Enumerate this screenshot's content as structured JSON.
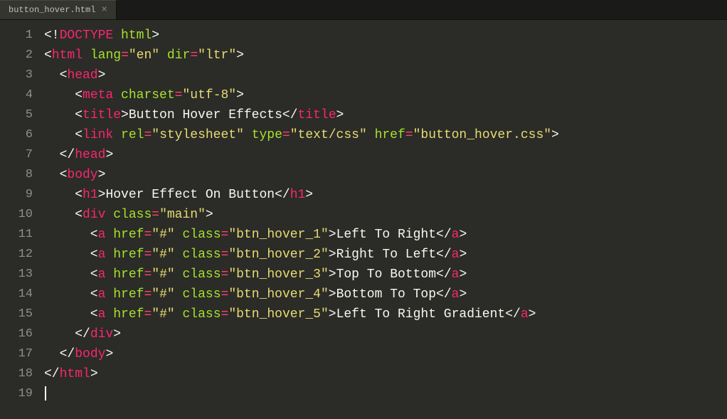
{
  "tab": {
    "filename": "button_hover.html",
    "close_glyph": "×"
  },
  "line_numbers": [
    "1",
    "2",
    "3",
    "4",
    "5",
    "6",
    "7",
    "8",
    "9",
    "10",
    "11",
    "12",
    "13",
    "14",
    "15",
    "16",
    "17",
    "18",
    "19"
  ],
  "code_lines": [
    [
      {
        "c": "pn",
        "t": "<!"
      },
      {
        "c": "tg",
        "t": "DOCTYPE"
      },
      {
        "c": "pn",
        "t": " "
      },
      {
        "c": "an",
        "t": "html"
      },
      {
        "c": "pn",
        "t": ">"
      }
    ],
    [
      {
        "c": "pn",
        "t": "<"
      },
      {
        "c": "tg",
        "t": "html"
      },
      {
        "c": "pn",
        "t": " "
      },
      {
        "c": "an",
        "t": "lang"
      },
      {
        "c": "op",
        "t": "="
      },
      {
        "c": "st",
        "t": "\"en\""
      },
      {
        "c": "pn",
        "t": " "
      },
      {
        "c": "an",
        "t": "dir"
      },
      {
        "c": "op",
        "t": "="
      },
      {
        "c": "st",
        "t": "\"ltr\""
      },
      {
        "c": "pn",
        "t": ">"
      }
    ],
    [
      {
        "c": "pn",
        "t": "  <"
      },
      {
        "c": "tg",
        "t": "head"
      },
      {
        "c": "pn",
        "t": ">"
      }
    ],
    [
      {
        "c": "pn",
        "t": "    <"
      },
      {
        "c": "tg",
        "t": "meta"
      },
      {
        "c": "pn",
        "t": " "
      },
      {
        "c": "an",
        "t": "charset"
      },
      {
        "c": "op",
        "t": "="
      },
      {
        "c": "st",
        "t": "\"utf-8\""
      },
      {
        "c": "pn",
        "t": ">"
      }
    ],
    [
      {
        "c": "pn",
        "t": "    <"
      },
      {
        "c": "tg",
        "t": "title"
      },
      {
        "c": "pn",
        "t": ">"
      },
      {
        "c": "tx",
        "t": "Button Hover Effects"
      },
      {
        "c": "pn",
        "t": "</"
      },
      {
        "c": "tg",
        "t": "title"
      },
      {
        "c": "pn",
        "t": ">"
      }
    ],
    [
      {
        "c": "pn",
        "t": "    <"
      },
      {
        "c": "tg",
        "t": "link"
      },
      {
        "c": "pn",
        "t": " "
      },
      {
        "c": "an",
        "t": "rel"
      },
      {
        "c": "op",
        "t": "="
      },
      {
        "c": "st",
        "t": "\"stylesheet\""
      },
      {
        "c": "pn",
        "t": " "
      },
      {
        "c": "an",
        "t": "type"
      },
      {
        "c": "op",
        "t": "="
      },
      {
        "c": "st",
        "t": "\"text/css\""
      },
      {
        "c": "pn",
        "t": " "
      },
      {
        "c": "an",
        "t": "href"
      },
      {
        "c": "op",
        "t": "="
      },
      {
        "c": "st",
        "t": "\"button_hover.css\""
      },
      {
        "c": "pn",
        "t": ">"
      }
    ],
    [
      {
        "c": "pn",
        "t": "  </"
      },
      {
        "c": "tg",
        "t": "head"
      },
      {
        "c": "pn",
        "t": ">"
      }
    ],
    [
      {
        "c": "pn",
        "t": "  <"
      },
      {
        "c": "tg",
        "t": "body"
      },
      {
        "c": "pn",
        "t": ">"
      }
    ],
    [
      {
        "c": "pn",
        "t": "    <"
      },
      {
        "c": "tg",
        "t": "h1"
      },
      {
        "c": "pn",
        "t": ">"
      },
      {
        "c": "tx",
        "t": "Hover Effect On Button"
      },
      {
        "c": "pn",
        "t": "</"
      },
      {
        "c": "tg",
        "t": "h1"
      },
      {
        "c": "pn",
        "t": ">"
      }
    ],
    [
      {
        "c": "pn",
        "t": "    <"
      },
      {
        "c": "tg",
        "t": "div"
      },
      {
        "c": "pn",
        "t": " "
      },
      {
        "c": "an",
        "t": "class"
      },
      {
        "c": "op",
        "t": "="
      },
      {
        "c": "st",
        "t": "\"main\""
      },
      {
        "c": "pn",
        "t": ">"
      }
    ],
    [
      {
        "c": "pn",
        "t": "      <"
      },
      {
        "c": "tg",
        "t": "a"
      },
      {
        "c": "pn",
        "t": " "
      },
      {
        "c": "an",
        "t": "href"
      },
      {
        "c": "op",
        "t": "="
      },
      {
        "c": "st",
        "t": "\"#\""
      },
      {
        "c": "pn",
        "t": " "
      },
      {
        "c": "an",
        "t": "class"
      },
      {
        "c": "op",
        "t": "="
      },
      {
        "c": "st",
        "t": "\"btn_hover_1\""
      },
      {
        "c": "pn",
        "t": ">"
      },
      {
        "c": "tx",
        "t": "Left To Right"
      },
      {
        "c": "pn",
        "t": "</"
      },
      {
        "c": "tg",
        "t": "a"
      },
      {
        "c": "pn",
        "t": ">"
      }
    ],
    [
      {
        "c": "pn",
        "t": "      <"
      },
      {
        "c": "tg",
        "t": "a"
      },
      {
        "c": "pn",
        "t": " "
      },
      {
        "c": "an",
        "t": "href"
      },
      {
        "c": "op",
        "t": "="
      },
      {
        "c": "st",
        "t": "\"#\""
      },
      {
        "c": "pn",
        "t": " "
      },
      {
        "c": "an",
        "t": "class"
      },
      {
        "c": "op",
        "t": "="
      },
      {
        "c": "st",
        "t": "\"btn_hover_2\""
      },
      {
        "c": "pn",
        "t": ">"
      },
      {
        "c": "tx",
        "t": "Right To Left"
      },
      {
        "c": "pn",
        "t": "</"
      },
      {
        "c": "tg",
        "t": "a"
      },
      {
        "c": "pn",
        "t": ">"
      }
    ],
    [
      {
        "c": "pn",
        "t": "      <"
      },
      {
        "c": "tg",
        "t": "a"
      },
      {
        "c": "pn",
        "t": " "
      },
      {
        "c": "an",
        "t": "href"
      },
      {
        "c": "op",
        "t": "="
      },
      {
        "c": "st",
        "t": "\"#\""
      },
      {
        "c": "pn",
        "t": " "
      },
      {
        "c": "an",
        "t": "class"
      },
      {
        "c": "op",
        "t": "="
      },
      {
        "c": "st",
        "t": "\"btn_hover_3\""
      },
      {
        "c": "pn",
        "t": ">"
      },
      {
        "c": "tx",
        "t": "Top To Bottom"
      },
      {
        "c": "pn",
        "t": "</"
      },
      {
        "c": "tg",
        "t": "a"
      },
      {
        "c": "pn",
        "t": ">"
      }
    ],
    [
      {
        "c": "pn",
        "t": "      <"
      },
      {
        "c": "tg",
        "t": "a"
      },
      {
        "c": "pn",
        "t": " "
      },
      {
        "c": "an",
        "t": "href"
      },
      {
        "c": "op",
        "t": "="
      },
      {
        "c": "st",
        "t": "\"#\""
      },
      {
        "c": "pn",
        "t": " "
      },
      {
        "c": "an",
        "t": "class"
      },
      {
        "c": "op",
        "t": "="
      },
      {
        "c": "st",
        "t": "\"btn_hover_4\""
      },
      {
        "c": "pn",
        "t": ">"
      },
      {
        "c": "tx",
        "t": "Bottom To Top"
      },
      {
        "c": "pn",
        "t": "</"
      },
      {
        "c": "tg",
        "t": "a"
      },
      {
        "c": "pn",
        "t": ">"
      }
    ],
    [
      {
        "c": "pn",
        "t": "      <"
      },
      {
        "c": "tg",
        "t": "a"
      },
      {
        "c": "pn",
        "t": " "
      },
      {
        "c": "an",
        "t": "href"
      },
      {
        "c": "op",
        "t": "="
      },
      {
        "c": "st",
        "t": "\"#\""
      },
      {
        "c": "pn",
        "t": " "
      },
      {
        "c": "an",
        "t": "class"
      },
      {
        "c": "op",
        "t": "="
      },
      {
        "c": "st",
        "t": "\"btn_hover_5\""
      },
      {
        "c": "pn",
        "t": ">"
      },
      {
        "c": "tx",
        "t": "Left To Right Gradient"
      },
      {
        "c": "pn",
        "t": "</"
      },
      {
        "c": "tg",
        "t": "a"
      },
      {
        "c": "pn",
        "t": ">"
      }
    ],
    [
      {
        "c": "pn",
        "t": "    </"
      },
      {
        "c": "tg",
        "t": "div"
      },
      {
        "c": "pn",
        "t": ">"
      }
    ],
    [
      {
        "c": "pn",
        "t": "  </"
      },
      {
        "c": "tg",
        "t": "body"
      },
      {
        "c": "pn",
        "t": ">"
      }
    ],
    [
      {
        "c": "pn",
        "t": "</"
      },
      {
        "c": "tg",
        "t": "html"
      },
      {
        "c": "pn",
        "t": ">"
      }
    ],
    []
  ],
  "cursor_line_index": 18
}
